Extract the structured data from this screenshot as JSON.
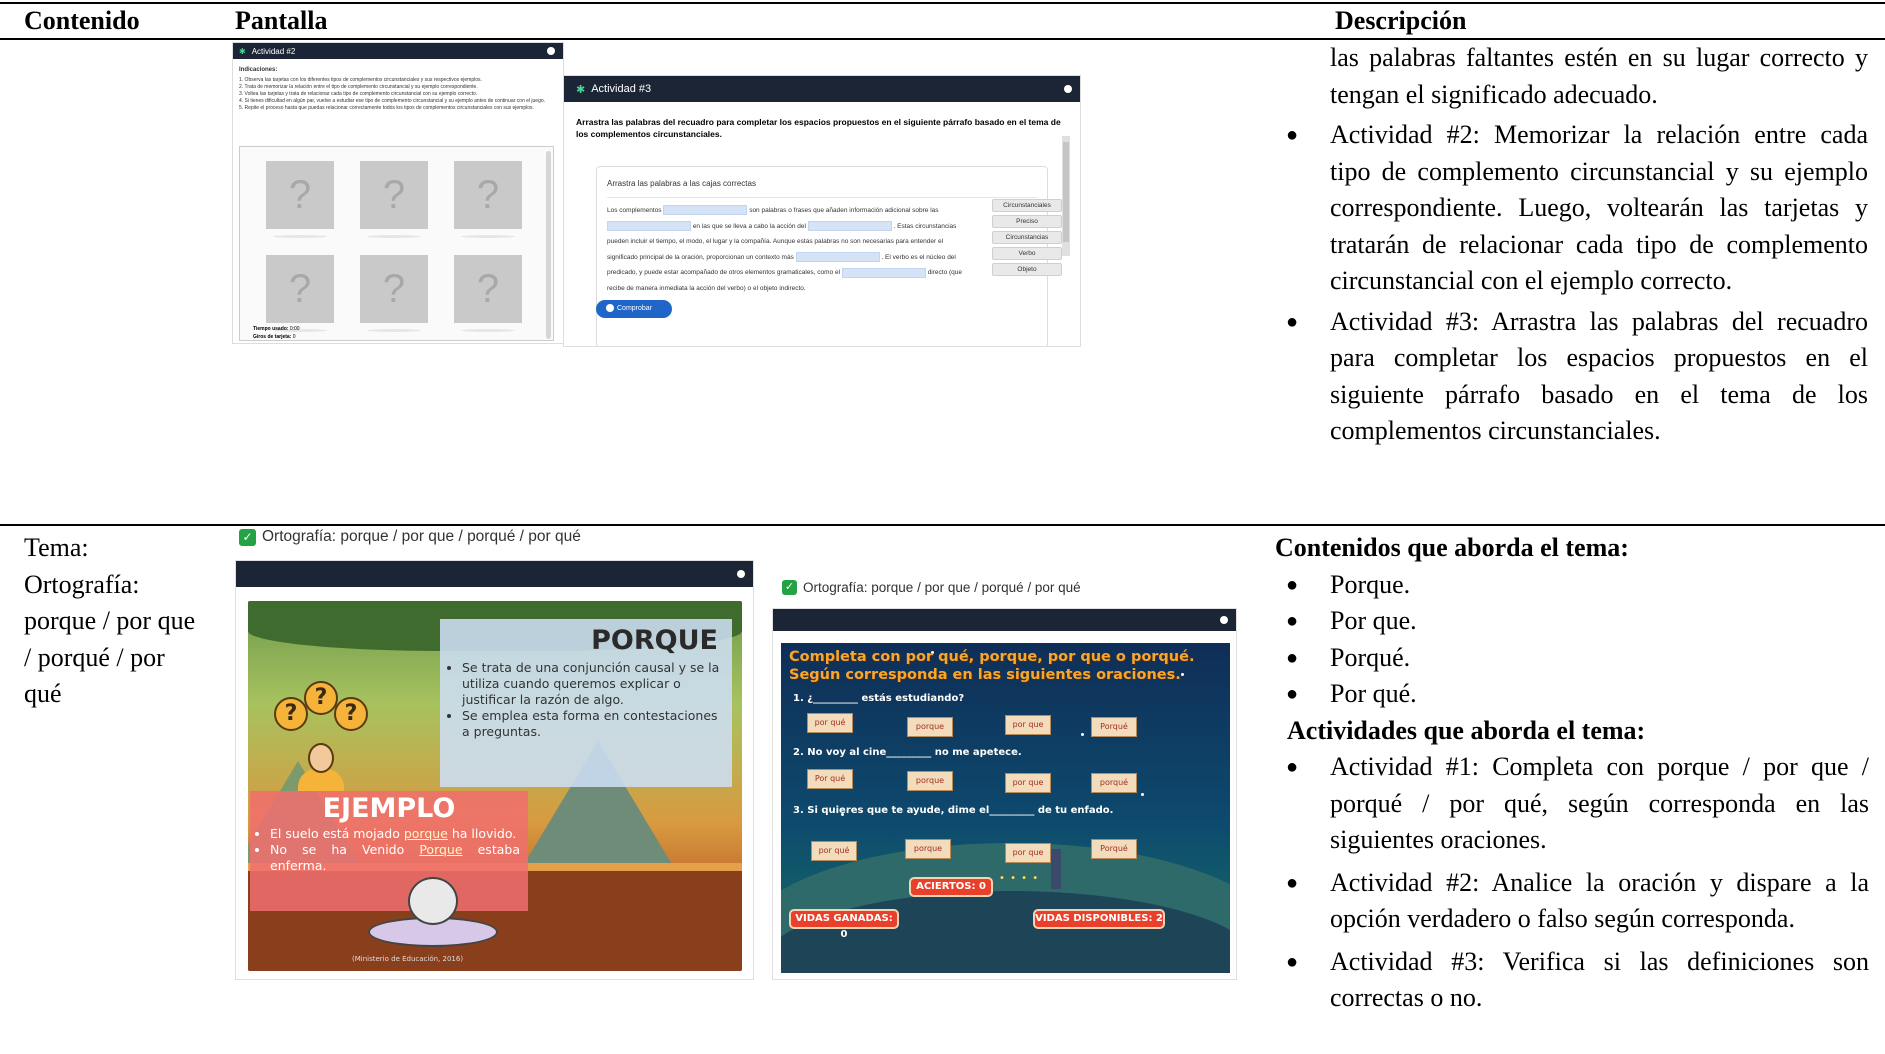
{
  "table": {
    "headers": {
      "contenido": "Contenido",
      "pantalla": "Pantalla",
      "descripcion": "Descripción"
    }
  },
  "row1": {
    "desc_continuation": "las palabras faltantes estén en su lugar correcto y tengan el significado adecuado.",
    "bullets": [
      "Actividad #2: Memorizar la relación entre cada tipo de complemento circunstancial y su ejemplo correspondiente. Luego, voltearán las tarjetas y tratarán de relacionar cada tipo de complemento circunstancial con el ejemplo correcto.",
      "Actividad #3: Arrastra las palabras del recuadro para completar los espacios propuestos en el siguiente párrafo basado en el tema de los complementos circunstanciales."
    ],
    "screen_a": {
      "title": "Actividad #2",
      "instructions_heading": "Indicaciones:",
      "instructions": [
        "1. Observa las tarjetas con los diferentes tipos de complementos circunstanciales y sus respectivos ejemplos.",
        "2. Trata de memorizar la relación entre el tipo de complemento circunstancial y su ejemplo correspondiente.",
        "3. Voltea las tarjetas y trata de relacionar cada tipo de complemento circunstancial con su ejemplo correcto.",
        "4. Si tienes dificultad en algún par, vuelve a estudiar ese tipo de complemento circunstancial y su ejemplo antes de continuar con el juego.",
        "5. Repite el proceso hasta que puedas relacionar correctamente todos los tipos de complementos circunstanciales con sus ejemplos."
      ],
      "card_symbol": "?",
      "time_label": "Tiempo usado:",
      "time_value": "0:00",
      "turns_label": "Giros de tarjeta:",
      "turns_value": "0"
    },
    "screen_b": {
      "title": "Actividad #3",
      "intro": "Arrastra las palabras del recuadro para completar los espacios propuestos en el siguiente párrafo basado en el tema de los complementos circunstanciales.",
      "box_title": "Arrastra las palabras a las cajas correctas",
      "p1": "Los complementos",
      "p2": "son palabras o frases que añaden información adicional sobre las",
      "p3": "en las que se lleva a cabo la acción del",
      "p4": ". Estas circunstancias pueden incluir el tiempo, el modo, el lugar y la compañía. Aunque estas palabras no son necesarias para entender el significado principal de la oración, proporcionan un contexto más",
      "p5": ". El verbo es el núcleo del predicado, y puede estar acompañado de otros elementos gramaticales, como el",
      "p6": "directo (que recibe de manera inmediata la acción del verbo) o el objeto indirecto.",
      "options": [
        "Circunstanciales",
        "Preciso",
        "Circunstancias",
        "Verbo",
        "Objeto"
      ],
      "check_button": "Comprobar"
    }
  },
  "row2": {
    "theme": "Tema: Ortografía: porque / por que / porqué / por qué",
    "contents_heading": "Contenidos que aborda el tema:",
    "contents": [
      "Porque.",
      "Por que.",
      "Porqué.",
      "Por qué."
    ],
    "activities_heading": "Actividades que aborda el tema:",
    "activities": [
      "Actividad #1: Completa con porque / por que / porqué / por qué, según corresponda en las siguientes oraciones.",
      "Actividad #2: Analice la oración y dispare a la opción verdadero o falso según corresponda.",
      "Actividad #3: Verifica si las definiciones son correctas o no."
    ],
    "screen_c": {
      "caption": "Ortografía: porque / por que / porqué / por qué",
      "box_title": "PORQUE",
      "box_items": [
        "Se trata de una conjunción causal y se la utiliza cuando queremos explicar o justificar la razón de algo.",
        "Se emplea esta forma en contestaciones a preguntas."
      ],
      "example_title": "EJEMPLO",
      "ex1_a": "El suelo está mojado ",
      "ex1_b": "porque",
      "ex1_c": " ha llovido.",
      "ex2_a": "No se ha Venido ",
      "ex2_b": "Porque",
      "ex2_c": " estaba enferma.",
      "credit": "(Ministerio de Educación, 2016)"
    },
    "screen_d": {
      "caption": "Ortografía: porque / por que / porqué / por qué",
      "title1": "Completa con por qué, porque, por que o porqué.",
      "title2": "Según corresponda en las siguientes oraciones.",
      "q1": "1. ¿_________ estás estudiando?",
      "q2": "2. No voy al cine_________ no me apetece.",
      "q3": "3. Si quieres que te ayude, dime el_________ de tu enfado.",
      "row1": [
        "por qué",
        "porque",
        "por que",
        "Porqué"
      ],
      "row2": [
        "Por qué",
        "porque",
        "por que",
        "porqué"
      ],
      "row3": [
        "por qué",
        "porque",
        "por que",
        "Porqué"
      ],
      "hits": "ACIERTOS: 0",
      "lives_won": "VIDAS GANADAS: 0",
      "lives_left": "VIDAS DISPONIBLES: 2"
    }
  }
}
